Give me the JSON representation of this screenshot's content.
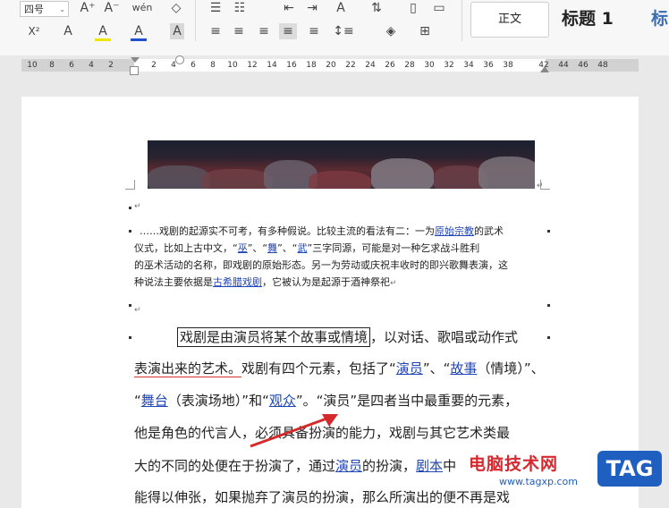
{
  "toolbar": {
    "font_size": "四号",
    "styles": {
      "normal": "正文",
      "heading1": "标题 1",
      "heading_partial": "标"
    },
    "glyphs": {
      "grow_font": "A⁺",
      "shrink_font": "A⁻",
      "phonetic": "wén",
      "eraser": "◇",
      "bullets": "☰",
      "numbering": "☷",
      "outdent": "⇤",
      "indent": "⇥",
      "char_fmt": "A",
      "sort": "⇅",
      "trash": "▯",
      "box": "▭",
      "superscript": "X²",
      "text_effect": "A",
      "highlight": "A",
      "font_color": "A",
      "char_shade": "A",
      "align_left": "≡",
      "align_center": "≡",
      "align_right": "≡",
      "justify": "≡",
      "distribute": "≡",
      "line_spacing": "↕≡",
      "shading": "◈",
      "borders": "⊞"
    },
    "colors": {
      "font_color_bar": "#1f4fcf",
      "highlight_bar": "#f2e600",
      "accent": "#3c6db0"
    }
  },
  "ruler": {
    "left_numbers": [
      "10",
      "8",
      "6",
      "4",
      "2"
    ],
    "right_numbers": [
      "2",
      "4",
      "6",
      "8",
      "10",
      "12",
      "14",
      "16",
      "18",
      "20",
      "22",
      "24",
      "26",
      "28",
      "30",
      "32",
      "34",
      "36",
      "38",
      "42",
      "44",
      "46",
      "48"
    ]
  },
  "document": {
    "paragraph1": [
      [
        "……戏剧的起源实不可考，有多种假说。比较主流的看法有二：一为",
        "原始宗教",
        "的武术"
      ],
      [
        "仪式，比如上古中文，“",
        "巫",
        "”、“",
        "舞",
        "”、“",
        "武",
        "”三字同源，可能是对一种乞求战斗胜利"
      ],
      [
        "的巫术活动的名称，即戏剧的原始形态。另一为劳动或庆祝丰收时的即兴歌舞表演，这"
      ],
      [
        "种说法主要依据是",
        "古希腊戏剧",
        "，它被认为是起源于酒神祭祀"
      ]
    ],
    "paragraph2": {
      "line1_boxed": "戏剧是由演员将某个故事或情境",
      "line1_rest": "，以对话、歌唱或动作式",
      "line2_red": "表演出来的艺术。",
      "line2_rest": [
        "戏剧有四个元素，包括了“",
        "演员",
        "”、“",
        "故事",
        "（情境）”、"
      ],
      "line3": [
        "“",
        "舞台",
        "（表演场地）”和“",
        "观众",
        "”。“演员”是四者当中最重要的元素，"
      ],
      "line4": "他是角色的代言人，必须具备扮演的能力，戏剧与其它艺术类最",
      "line5": [
        "大的不同的处便在于扮演了，通过",
        "演员",
        "的扮演，",
        "剧本",
        "中"
      ],
      "line6": "能得以伸张，如果抛弃了演员的扮演，那么所演出的便不再是戏"
    },
    "para_marks": {
      "return": "↵"
    }
  },
  "watermark": {
    "title": "电脑技术网",
    "url": "www.tagxp.com",
    "badge": "TAG"
  }
}
